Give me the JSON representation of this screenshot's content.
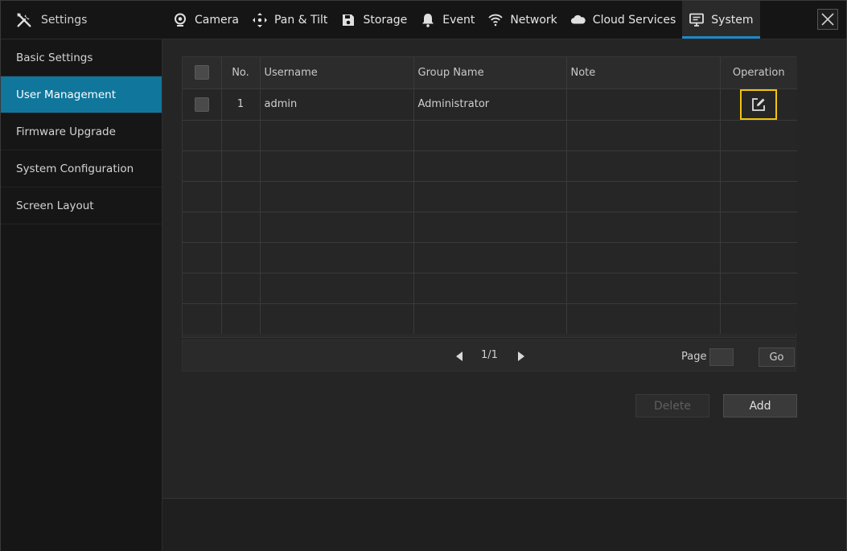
{
  "header": {
    "title": "Settings",
    "tabs": [
      {
        "label": "Camera",
        "icon": "camera-icon"
      },
      {
        "label": "Pan & Tilt",
        "icon": "pan-tilt-icon"
      },
      {
        "label": "Storage",
        "icon": "storage-icon"
      },
      {
        "label": "Event",
        "icon": "bell-icon"
      },
      {
        "label": "Network",
        "icon": "wifi-icon"
      },
      {
        "label": "Cloud Services",
        "icon": "cloud-icon"
      },
      {
        "label": "System",
        "icon": "monitor-icon",
        "active": true
      }
    ]
  },
  "sidebar": {
    "items": [
      {
        "label": "Basic Settings"
      },
      {
        "label": "User Management",
        "active": true
      },
      {
        "label": "Firmware Upgrade"
      },
      {
        "label": "System Configuration"
      },
      {
        "label": "Screen Layout"
      }
    ]
  },
  "table": {
    "columns": [
      "No.",
      "Username",
      "Group Name",
      "Note",
      "Operation"
    ],
    "rows": [
      {
        "no": "1",
        "username": "admin",
        "group": "Administrator",
        "note": ""
      }
    ]
  },
  "pager": {
    "page_text": "1/1",
    "page_label": "Page",
    "go_label": "Go"
  },
  "actions": {
    "delete_label": "Delete",
    "add_label": "Add"
  },
  "colors": {
    "accent": "#10769c",
    "highlight": "#f2c40f",
    "background": "#232323"
  }
}
